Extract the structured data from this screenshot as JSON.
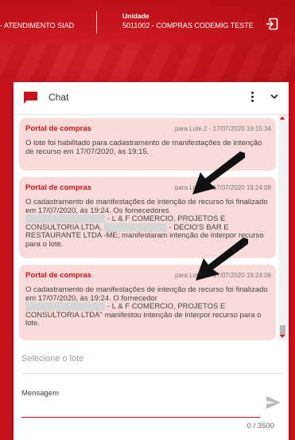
{
  "header": {
    "left_text": "- ATENDIMENTO SIAD",
    "unit_label": "Unidade",
    "unit_value": "5011002 - COMPRAS CODEMIG TESTE"
  },
  "chat": {
    "title": "Chat",
    "messages": [
      {
        "from": "Portal de compras",
        "meta": "para Lote 2 - 17/07/2020 19:15:34",
        "body": "O lote foi habilitado para cadastramento de manifestações de intenção de recurso em 17/07/2020, às 19:15."
      },
      {
        "from": "Portal de compras",
        "meta": "para Lote 1 - 17/07/2020 19:24:09",
        "body_1": "O cadastramento de manifestações de intenção de recurso foi finalizado em 17/07/2020, às 19:24. Os fornecedores",
        "body_2": "- L & F COMERCIO, PROJETOS E CONSULTORIA LTDA,",
        "body_3": "- DECIO'S BAR E RESTAURANTE LTDA -ME; manifestaram intenção de interpor recurso para o lote."
      },
      {
        "from": "Portal de compras",
        "meta": "para Lote 2 - 17/07/2020 19:24:09",
        "body_1": "O cadastramento de manifestações de intenção de recurso foi finalizado em 17/07/2020, às 19:24. O fornecedor",
        "body_2": "- L & F COMERCIO, PROJETOS E CONSULTORIA LTDA\" manifestou intenção de interpor recurso para o lote."
      }
    ]
  },
  "form": {
    "lot_placeholder": "Selecione o lote",
    "message_label": "Mensagem",
    "counter": "0 / 3500"
  },
  "colors": {
    "brand_red": "#c8121a",
    "bubble_pink": "#fbdada"
  },
  "icons": [
    "exit-icon",
    "chat-bubble-icon",
    "more-vert-icon",
    "chevron-down-icon",
    "send-icon",
    "arrow-pointer-icon"
  ]
}
